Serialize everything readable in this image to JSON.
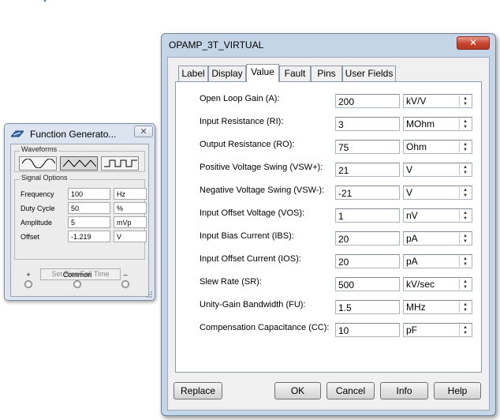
{
  "function_generator": {
    "title": "Function Generato...",
    "waveforms_label": "Waveforms",
    "signal_options_label": "Signal Options",
    "rows": [
      {
        "name": "Frequency",
        "value": "100",
        "unit": "Hz"
      },
      {
        "name": "Duty Cycle",
        "value": "50",
        "unit": "%"
      },
      {
        "name": "Amplitude",
        "value": "5",
        "unit": "mVp"
      },
      {
        "name": "Offset",
        "value": "-1.219",
        "unit": "V"
      }
    ],
    "rise_fall_button": "Set Rise/Fall Time",
    "terminals": {
      "plus": "+",
      "common": "Common",
      "minus": "–"
    },
    "close_icon": "close-icon",
    "selected_waveform": "triangle"
  },
  "opamp_dialog": {
    "title": "OPAMP_3T_VIRTUAL",
    "close_glyph": "✕",
    "tabs": [
      "Label",
      "Display",
      "Value",
      "Fault",
      "Pins",
      "User Fields"
    ],
    "active_tab": "Value",
    "params": [
      {
        "label": "Open Loop Gain (A):",
        "value": "200",
        "unit": "kV/V"
      },
      {
        "label": "Input Resistance (RI):",
        "value": "3",
        "unit": "MOhm"
      },
      {
        "label": "Output Resistance (RO):",
        "value": "75",
        "unit": "Ohm"
      },
      {
        "label": "Positive Voltage Swing (VSW+):",
        "value": "21",
        "unit": "V"
      },
      {
        "label": "Negative Voltage Swing (VSW-):",
        "value": "-21",
        "unit": "V"
      },
      {
        "label": "Input Offset Voltage (VOS):",
        "value": "1",
        "unit": "nV"
      },
      {
        "label": "Input Bias Current (IBS):",
        "value": "20",
        "unit": "pA"
      },
      {
        "label": "Input Offset Current (IOS):",
        "value": "20",
        "unit": "pA"
      },
      {
        "label": "Slew Rate (SR):",
        "value": "500",
        "unit": "kV/sec"
      },
      {
        "label": "Unity-Gain Bandwidth (FU):",
        "value": "1.5",
        "unit": "MHz"
      },
      {
        "label": "Compensation Capacitance (CC):",
        "value": "10",
        "unit": "pF"
      }
    ],
    "buttons": {
      "replace": "Replace",
      "ok": "OK",
      "cancel": "Cancel",
      "info": "Info",
      "help": "Help"
    }
  },
  "colors": {
    "window_frame": "#c5d5e8",
    "close_red": "#c7432c",
    "panel": "#f0f0f0"
  }
}
